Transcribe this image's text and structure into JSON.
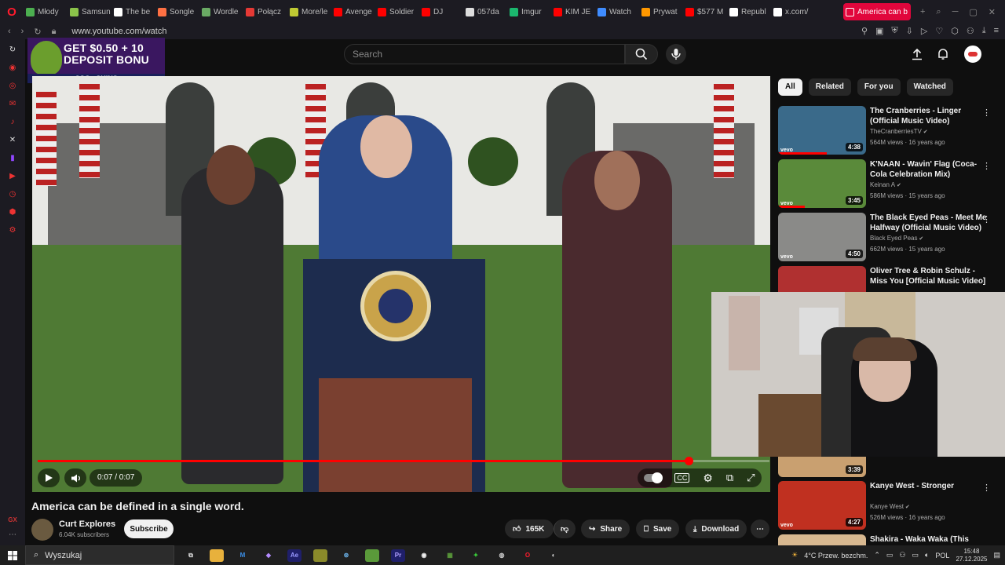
{
  "browser": {
    "tabs": [
      {
        "label": "Młody",
        "fav_color": "#4caf50"
      },
      {
        "label": "Samsun",
        "fav_color": "#8bc34a"
      },
      {
        "label": "The be",
        "fav_color": "#ffffff"
      },
      {
        "label": "Songle",
        "fav_color": "#ff7043"
      },
      {
        "label": "Wordle",
        "fav_color": "#6aaa64"
      },
      {
        "label": "Połącz",
        "fav_color": "#e53935"
      },
      {
        "label": "More/le",
        "fav_color": "#c0ca33"
      },
      {
        "label": "Avenge",
        "fav_color": "#ff0000"
      },
      {
        "label": "Soldier",
        "fav_color": "#ff0000"
      },
      {
        "label": "DJ",
        "fav_color": "#ff0000"
      },
      {
        "label": "057da",
        "fav_color": "#dddddd"
      },
      {
        "label": "Imgur",
        "fav_color": "#1bb76e"
      },
      {
        "label": "KIM JE",
        "fav_color": "#ff0000"
      },
      {
        "label": "Watch",
        "fav_color": "#3f8cff"
      },
      {
        "label": "Prywat",
        "fav_color": "#ff9800"
      },
      {
        "label": "$577 M",
        "fav_color": "#ff0000"
      },
      {
        "label": "Republ",
        "fav_color": "#ffffff"
      },
      {
        "label": "x.com/",
        "fav_color": "#ffffff"
      }
    ],
    "active_tab": {
      "label": "America can b",
      "fav_color": "#ffffff"
    },
    "url": "www.youtube.com/watch",
    "accent": "#e1063c"
  },
  "ad": {
    "line1": "GET $0.50 + 10",
    "line2": "DEPOSIT BONU",
    "brand": "CSG⊙SKINS"
  },
  "youtube": {
    "search_placeholder": "Search",
    "video_title": "America can be defined in a single word.",
    "time_display": "0:07 / 0:07",
    "progress_fraction": 0.89,
    "channel_name": "Curt Explores",
    "channel_subs": "6.04K subscribers",
    "subscribe_label": "Subscribe",
    "like_count": "165K",
    "share_label": "Share",
    "save_label": "Save",
    "download_label": "Download",
    "chips": [
      "All",
      "Related",
      "For you",
      "Watched"
    ],
    "recommendations": [
      {
        "title": "The Cranberries - Linger (Official Music Video)",
        "channel": "TheCranberriesTV",
        "views": "564M views · 16 years ago",
        "duration": "4:38",
        "thumb_color": "#3a6a8a",
        "watched_fraction": 0.55
      },
      {
        "title": "K'NAAN - Wavin' Flag (Coca-Cola Celebration Mix)",
        "channel": "Keinan A",
        "views": "586M views · 15 years ago",
        "duration": "3:45",
        "thumb_color": "#5a8a3a",
        "watched_fraction": 0.3
      },
      {
        "title": "The Black Eyed Peas - Meet Me Halfway (Official Music Video)",
        "channel": "Black Eyed Peas",
        "views": "662M views · 15 years ago",
        "duration": "4:50",
        "thumb_color": "#8a8a88",
        "watched_fraction": 0.0
      },
      {
        "title": "Oliver Tree & Robin Schulz - Miss You [Official Music Video]",
        "channel": "",
        "views": "",
        "duration": "",
        "thumb_color": "#b03030",
        "watched_fraction": 0.0
      },
      {
        "title": "",
        "channel": "",
        "views": "",
        "duration": "3:39",
        "thumb_color": "#c9a070",
        "watched_fraction": 0.0
      },
      {
        "title": "Kanye West - Stronger",
        "channel": "Kanye West",
        "views": "526M views · 16 years ago",
        "duration": "4:27",
        "thumb_color": "#c03020",
        "watched_fraction": 0.0
      },
      {
        "title": "Shakira - Waka Waka (This Time",
        "channel": "",
        "views": "",
        "duration": "",
        "thumb_color": "#d8b890",
        "watched_fraction": 0.0
      }
    ]
  },
  "taskbar": {
    "search_placeholder": "Wyszukaj",
    "weather": "4°C  Przew. bezchm.",
    "lang": "POL",
    "time": "15:48",
    "date": "27.12.2025"
  },
  "sidebar": {
    "gx_label": "GX"
  }
}
